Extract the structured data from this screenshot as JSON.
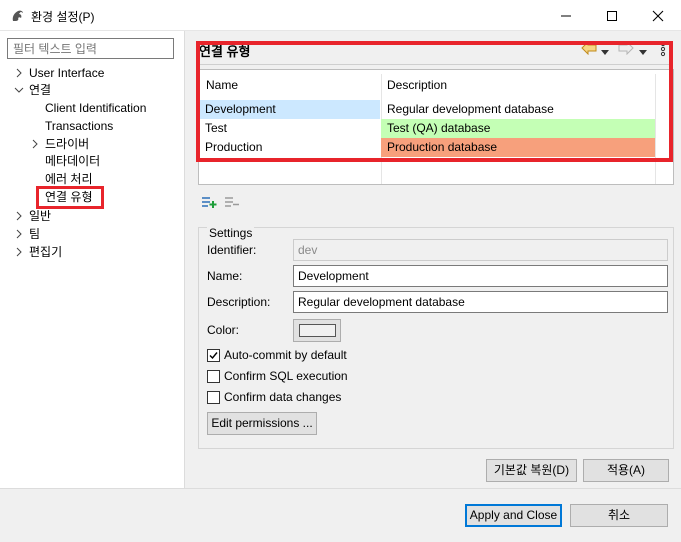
{
  "window": {
    "title": "환경 설정(P)"
  },
  "filter": {
    "placeholder": "필터 텍스트 입력"
  },
  "tree": {
    "user_interface": "User Interface",
    "connections": "연결",
    "client_identification": "Client Identification",
    "transactions": "Transactions",
    "drivers": "드라이버",
    "metadata": "메타데이터",
    "error_handling": "에러 처리",
    "connection_types": "연결 유형",
    "general": "일반",
    "team": "팀",
    "editors": "편집기"
  },
  "page": {
    "title": "연결 유형"
  },
  "table": {
    "headers": [
      "Name",
      "Description"
    ],
    "rows": [
      {
        "name": "Development",
        "description": "Regular development database",
        "color": "#ffffff"
      },
      {
        "name": "Test",
        "description": "Test (QA) database",
        "color": "#c4ffb5"
      },
      {
        "name": "Production",
        "description": "Production database",
        "color": "#f7a07c"
      }
    ]
  },
  "settings": {
    "legend": "Settings",
    "identifier_label": "Identifier:",
    "identifier_value": "dev",
    "name_label": "Name:",
    "name_value": "Development",
    "description_label": "Description:",
    "description_value": "Regular development database",
    "color_label": "Color:",
    "autocommit_label": "Auto-commit by default",
    "autocommit_checked": true,
    "confirm_sql_label": "Confirm SQL execution",
    "confirm_sql_checked": false,
    "confirm_data_label": "Confirm data changes",
    "confirm_data_checked": false,
    "edit_permissions": "Edit permissions ..."
  },
  "buttons": {
    "restore_defaults": "기본값 복원(D)",
    "apply": "적용(A)",
    "apply_and_close": "Apply and Close",
    "cancel": "취소"
  },
  "colors": {
    "highlight": "#e8242b",
    "selection": "#cce8ff",
    "test_row": "#c4ffb5",
    "production_row": "#f7a07c",
    "add_icon": "#1e9e3a",
    "default_button_border": "#0078d7"
  }
}
